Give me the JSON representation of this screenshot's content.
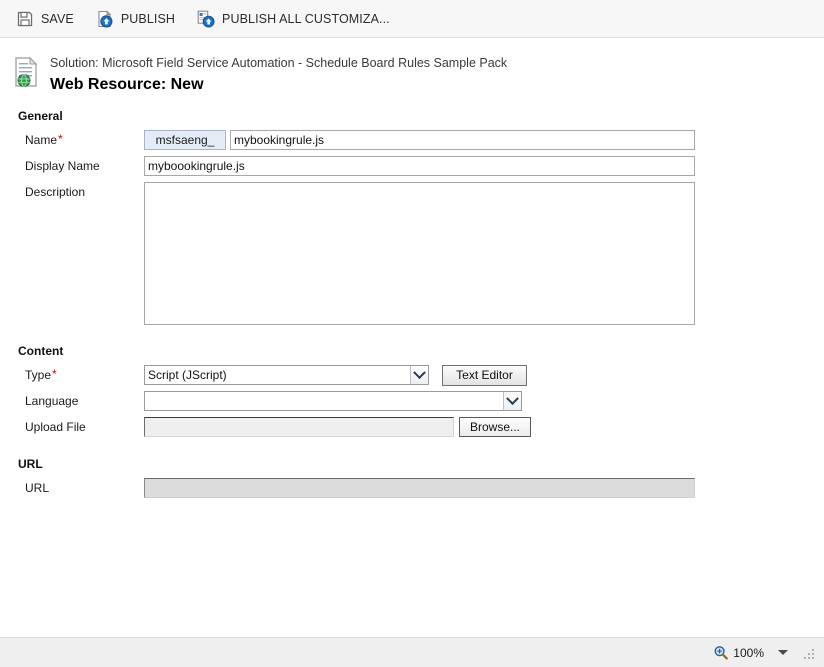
{
  "command_bar": {
    "buttons": [
      {
        "label": "SAVE",
        "icon": "save-floppy-icon"
      },
      {
        "label": "PUBLISH",
        "icon": "publish-upload-icon"
      },
      {
        "label": "PUBLISH ALL CUSTOMIZA...",
        "icon": "publish-all-upload-icon"
      }
    ]
  },
  "header": {
    "icon": "web-resource-document-globe-icon",
    "solution_line": "Solution: Microsoft Field Service Automation - Schedule Board Rules Sample Pack",
    "record_title": "Web Resource: New"
  },
  "form": {
    "general": {
      "section_label": "General",
      "name": {
        "label": "Name",
        "required_marker": "*",
        "prefix": "msfsaeng_",
        "value": "mybookingrule.js",
        "placeholder": ""
      },
      "display_name": {
        "label": "Display Name",
        "value": "myboookingrule.js",
        "placeholder": ""
      },
      "description": {
        "label": "Description",
        "value": "",
        "placeholder": ""
      }
    },
    "content": {
      "section_label": "Content",
      "type": {
        "label": "Type",
        "required_marker": "*",
        "value": "Script (JScript)",
        "options": [
          "Script (JScript)"
        ]
      },
      "text_editor_button": "Text Editor",
      "language": {
        "label": "Language",
        "value": "",
        "options": [
          ""
        ]
      },
      "upload_file": {
        "label": "Upload File",
        "value": "",
        "placeholder": ""
      },
      "browse_button": "Browse..."
    },
    "url": {
      "section_label": "URL",
      "url": {
        "label": "URL",
        "value": "",
        "placeholder": ""
      }
    }
  },
  "status_bar": {
    "zoom_icon": "magnifier-zoom-icon",
    "zoom_level": "100%"
  },
  "colors": {
    "command_bar_bg": "#f7f7f7",
    "required_asterisk": "#d60000",
    "prefix_bg": "#e4ecf7",
    "readonly_bg": "#dcdcdc",
    "status_bar_bg": "#efefef"
  }
}
